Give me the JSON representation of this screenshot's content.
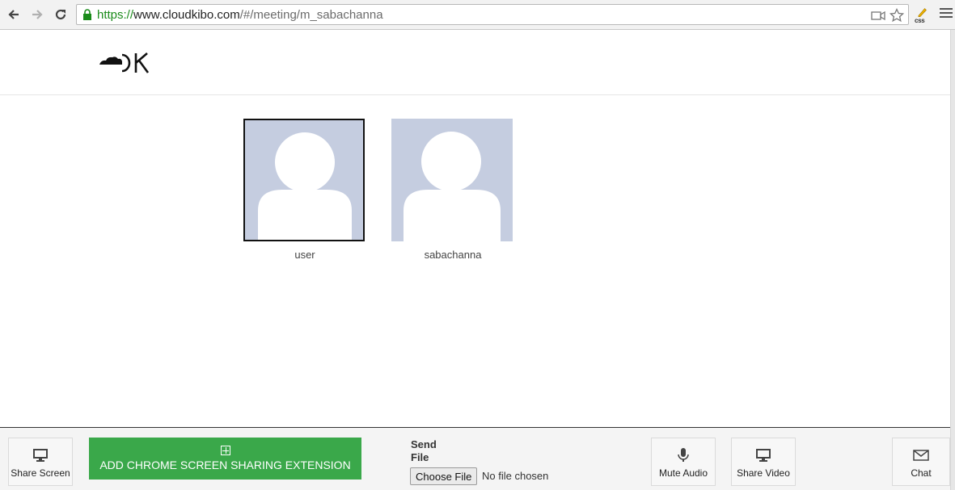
{
  "browser": {
    "url_secure": "https://",
    "url_host": "www.cloudkibo.com",
    "url_path": "/#/meeting/m_sabachanna",
    "extension_label": "css"
  },
  "participants": [
    {
      "name": "user",
      "active": true
    },
    {
      "name": "sabachanna",
      "active": false
    }
  ],
  "toolbar": {
    "share_screen": "Share Screen",
    "add_extension": "ADD CHROME SCREEN SHARING EXTENSION",
    "send_file": "Send File",
    "choose_file": "Choose File",
    "no_file": "No file chosen",
    "mute_audio": "Mute Audio",
    "share_video": "Share Video",
    "chat": "Chat"
  },
  "colors": {
    "extension_button": "#3aa84a",
    "avatar_bg": "#c5cde0",
    "secure_url": "#1a8b1a"
  }
}
